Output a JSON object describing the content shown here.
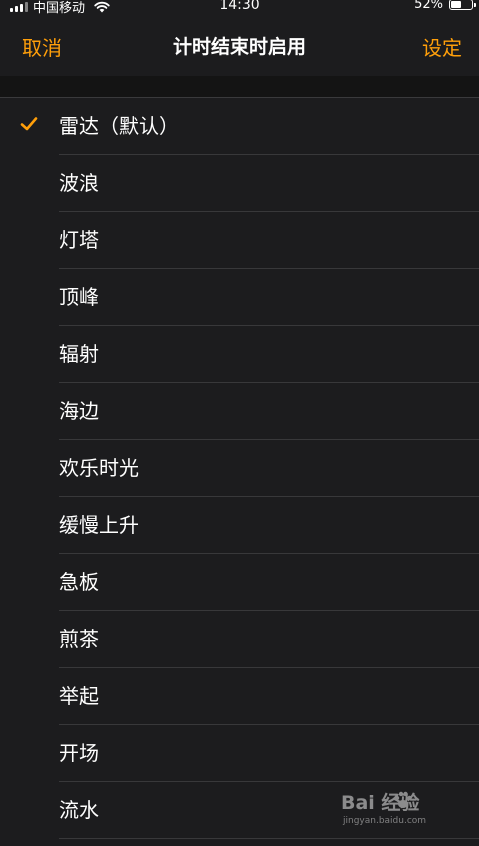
{
  "status_bar": {
    "carrier": "中国移动",
    "time": "14:30",
    "battery_percent": "52%",
    "battery_level": 0.52,
    "icons": [
      "signal-icon",
      "wifi-icon",
      "battery-icon"
    ]
  },
  "nav": {
    "cancel_label": "取消",
    "title": "计时结束时启用",
    "set_label": "设定"
  },
  "colors": {
    "accent": "#ff9f0a",
    "background": "#1c1c1e",
    "separator": "#38383a",
    "text": "#ffffff"
  },
  "options": [
    {
      "label": "雷达（默认）",
      "selected": true
    },
    {
      "label": "波浪",
      "selected": false
    },
    {
      "label": "灯塔",
      "selected": false
    },
    {
      "label": "顶峰",
      "selected": false
    },
    {
      "label": "辐射",
      "selected": false
    },
    {
      "label": "海边",
      "selected": false
    },
    {
      "label": "欢乐时光",
      "selected": false
    },
    {
      "label": "缓慢上升",
      "selected": false
    },
    {
      "label": "急板",
      "selected": false
    },
    {
      "label": "煎茶",
      "selected": false
    },
    {
      "label": "举起",
      "selected": false
    },
    {
      "label": "开场",
      "selected": false
    },
    {
      "label": "流水",
      "selected": false
    }
  ],
  "watermark": {
    "text": "Bai 经验",
    "url": "jingyan.baidu.com"
  }
}
